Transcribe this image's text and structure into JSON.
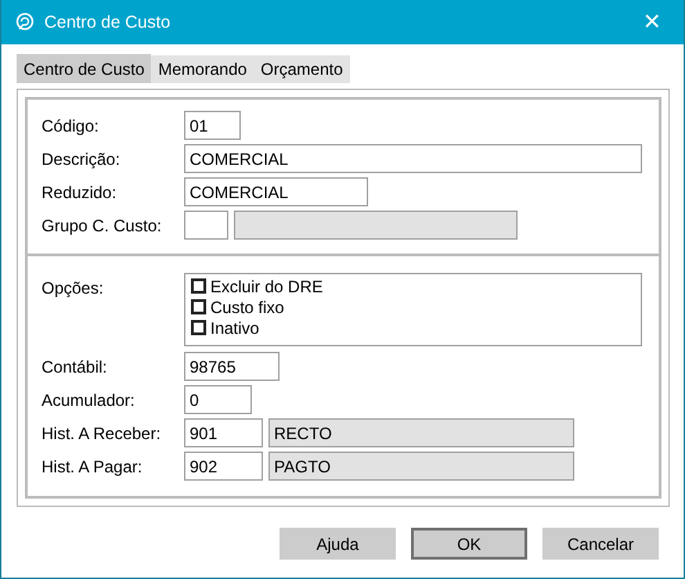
{
  "window": {
    "title": "Centro de Custo",
    "close": "✕"
  },
  "tabs": [
    {
      "label": "Centro de Custo",
      "selected": true
    },
    {
      "label": "Memorando",
      "selected": false
    },
    {
      "label": "Orçamento",
      "selected": false
    }
  ],
  "sections": [
    {
      "rows": [
        {
          "kind": "field",
          "label": "Código:",
          "value": "01"
        },
        {
          "kind": "field",
          "label": "Descrição:",
          "value": "COMERCIAL"
        },
        {
          "kind": "field",
          "label": "Reduzido:",
          "value": "COMERCIAL"
        },
        {
          "kind": "pair",
          "label": "Grupo C. Custo:",
          "desc_disabled": true
        }
      ]
    },
    {
      "rows": [
        {
          "kind": "options",
          "label": "Opções:",
          "options": [
            {
              "label": "Excluir do DRE",
              "checked": false
            },
            {
              "label": "Custo fixo",
              "checked": false
            },
            {
              "label": "Inativo",
              "checked": false
            }
          ]
        },
        {
          "kind": "field",
          "label": "Contábil:",
          "value": "98765"
        },
        {
          "kind": "field",
          "label": "Acumulador:",
          "value": "0"
        },
        {
          "kind": "pair",
          "label": "Hist. A Receber:",
          "code": "901",
          "desc": "RECTO",
          "desc_disabled": true
        },
        {
          "kind": "pair",
          "label": "Hist. A Pagar:",
          "code": "902",
          "desc": "PAGTO",
          "desc_disabled": true
        }
      ]
    }
  ],
  "buttons": [
    {
      "label": "Ajuda",
      "default": false
    },
    {
      "label": "OK",
      "default": true
    },
    {
      "label": "Cancelar",
      "default": false
    }
  ]
}
